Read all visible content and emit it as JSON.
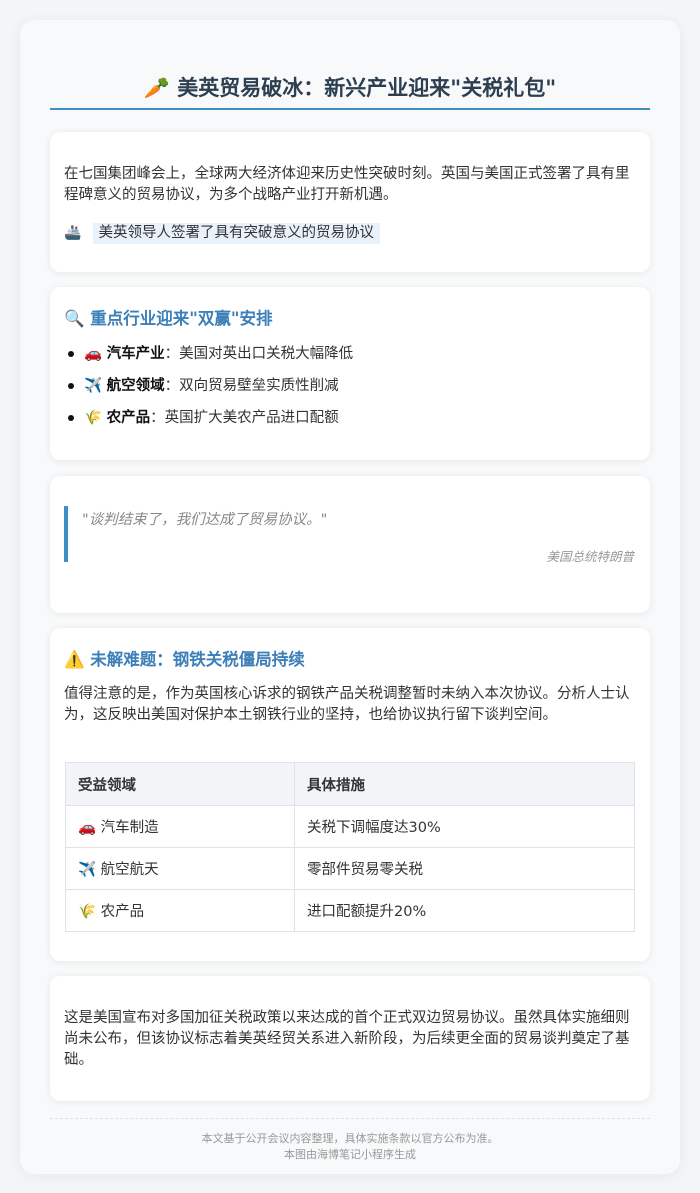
{
  "header": {
    "icon": "🥕",
    "title": "美英贸易破冰：新兴产业迎来\"关税礼包\""
  },
  "intro": {
    "paragraph": "在七国集团峰会上，全球两大经济体迎来历史性突破时刻。英国与美国正式签署了具有里程碑意义的贸易协议，为多个战略产业打开新机遇。",
    "highlight_icon": "🚢",
    "highlight_text": "美英领导人签署了具有突破意义的贸易协议"
  },
  "industries": {
    "icon": "🔍",
    "title": "重点行业迎来\"双赢\"安排",
    "items": [
      {
        "icon": "🚗",
        "name": "汽车产业",
        "desc": "：美国对英出口关税大幅降低"
      },
      {
        "icon": "✈️",
        "name": "航空领域",
        "desc": "：双向贸易壁垒实质性削减"
      },
      {
        "icon": "🌾",
        "name": "农产品",
        "desc": "：英国扩大美农产品进口配额"
      }
    ]
  },
  "quote": {
    "text": "\"谈判结束了，我们达成了贸易协议。\"",
    "author": "美国总统特朗普"
  },
  "issue": {
    "icon": "⚠️",
    "title": "未解难题：钢铁关税僵局持续",
    "paragraph": "值得注意的是，作为英国核心诉求的钢铁产品关税调整暂时未纳入本次协议。分析人士认为，这反映出美国对保护本土钢铁行业的坚持，也给协议执行留下谈判空间。",
    "table": {
      "headers": [
        "受益领域",
        "具体措施"
      ],
      "rows": [
        {
          "icon": "🚗",
          "field": "汽车制造",
          "measure": "关税下调幅度达30%"
        },
        {
          "icon": "✈️",
          "field": "航空航天",
          "measure": "零部件贸易零关税"
        },
        {
          "icon": "🌾",
          "field": "农产品",
          "measure": "进口配额提升20%"
        }
      ]
    }
  },
  "conclusion": {
    "paragraph": "这是美国宣布对多国加征关税政策以来达成的首个正式双边贸易协议。虽然具体实施细则尚未公布，但该协议标志着美英经贸关系进入新阶段，为后续更全面的贸易谈判奠定了基础。"
  },
  "footer": {
    "line1": "本文基于公开会议内容整理，具体实施条款以官方公布为准。",
    "line2": "本图由海博笔记小程序生成"
  },
  "colors": {
    "accent": "#3d8fc4",
    "title_blue": "#3d7fb8",
    "heading": "#2c3e50"
  }
}
